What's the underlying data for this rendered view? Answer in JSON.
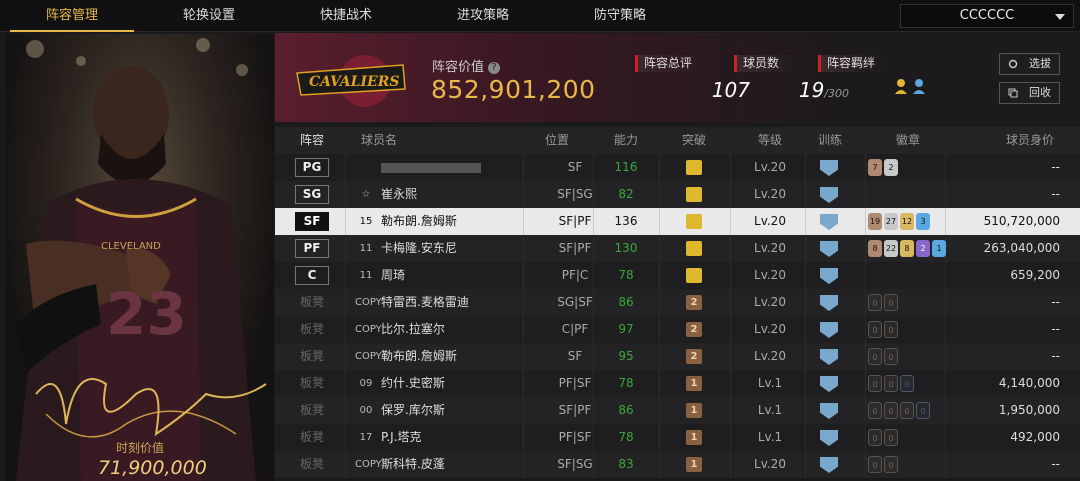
{
  "tabs": [
    "阵容管理",
    "轮换设置",
    "快捷战术",
    "进攻策略",
    "防守策略"
  ],
  "dropdown": "CCCCCC",
  "portrait": {
    "market_label": "时刻价值",
    "market_value": "71,900,000",
    "jersey": "23",
    "team_text": "CLEVELAND"
  },
  "team": {
    "logo_text": "CAVALIERS",
    "value_label": "阵容价值",
    "value": "852,901,200"
  },
  "stats": {
    "total_label": "阵容总评",
    "total": "107",
    "count_label": "球员数",
    "count": "19",
    "count_max": "/300",
    "bond_label": "阵容羁绊"
  },
  "buttons": {
    "select": "选拔",
    "recycle": "回收"
  },
  "columns": [
    "阵容",
    "球员名",
    "位置",
    "能力",
    "突破",
    "等级",
    "训练",
    "徽章",
    "球员身价"
  ],
  "players": [
    {
      "slot": "PG",
      "slot_type": "pos",
      "num": "",
      "name": "",
      "pos": "SF",
      "rating": "116",
      "break": "gold",
      "level": "Lv.20",
      "badges": [
        [
          "b-br",
          "7"
        ],
        [
          "b-si",
          "2"
        ]
      ],
      "value": "--"
    },
    {
      "slot": "SG",
      "slot_type": "pos",
      "num": "☆",
      "name": "崔永熙",
      "pos": "SF|SG",
      "rating": "82",
      "break": "gold",
      "level": "Lv.20",
      "badges": [],
      "value": "--"
    },
    {
      "slot": "SF",
      "slot_type": "pos",
      "num": "15",
      "name": "勒布朗.詹姆斯",
      "pos": "SF|PF",
      "rating": "136",
      "break": "gold",
      "level": "Lv.20",
      "badges": [
        [
          "b-br",
          "19"
        ],
        [
          "b-si",
          "27"
        ],
        [
          "b-go",
          "12"
        ],
        [
          "b-bl",
          "3"
        ]
      ],
      "value": "510,720,000",
      "selected": true
    },
    {
      "slot": "PF",
      "slot_type": "pos",
      "num": "11",
      "name": "卡梅隆.安东尼",
      "pos": "SF|PF",
      "rating": "130",
      "break": "gold",
      "level": "Lv.20",
      "badges": [
        [
          "b-br",
          "8"
        ],
        [
          "b-si",
          "22"
        ],
        [
          "b-go",
          "8"
        ],
        [
          "b-pu",
          "2"
        ],
        [
          "b-bl",
          "1"
        ]
      ],
      "value": "263,040,000"
    },
    {
      "slot": "C",
      "slot_type": "pos",
      "num": "11",
      "name": "周琦",
      "pos": "PF|C",
      "rating": "78",
      "break": "gold",
      "level": "Lv.20",
      "badges": [],
      "value": "659,200"
    },
    {
      "slot": "板凳",
      "slot_type": "bench",
      "num": "COPY",
      "name": "特雷西.麦格雷迪",
      "pos": "SG|SF",
      "rating": "86",
      "break": "2",
      "level": "Lv.20",
      "badges": [
        [
          "b-em",
          "0"
        ],
        [
          "b-em",
          "0"
        ]
      ],
      "value": "--"
    },
    {
      "slot": "板凳",
      "slot_type": "bench",
      "num": "COPY",
      "name": "比尔.拉塞尔",
      "pos": "C|PF",
      "rating": "97",
      "break": "2",
      "level": "Lv.20",
      "badges": [
        [
          "b-em",
          "0"
        ],
        [
          "b-em",
          "0"
        ]
      ],
      "value": "--"
    },
    {
      "slot": "板凳",
      "slot_type": "bench",
      "num": "COPY",
      "name": "勒布朗.詹姆斯",
      "pos": "SF",
      "rating": "95",
      "break": "2",
      "level": "Lv.20",
      "badges": [
        [
          "b-em",
          "0"
        ],
        [
          "b-em",
          "0"
        ]
      ],
      "value": "--"
    },
    {
      "slot": "板凳",
      "slot_type": "bench",
      "num": "09",
      "name": "约什.史密斯",
      "pos": "PF|SF",
      "rating": "78",
      "break": "1",
      "level": "Lv.1",
      "badges": [
        [
          "b-em",
          "0"
        ],
        [
          "b-em",
          "0"
        ],
        [
          "b-emb",
          "0"
        ]
      ],
      "value": "4,140,000"
    },
    {
      "slot": "板凳",
      "slot_type": "bench",
      "num": "00",
      "name": "保罗.库尔斯",
      "pos": "SF|PF",
      "rating": "86",
      "break": "1",
      "level": "Lv.1",
      "badges": [
        [
          "b-em",
          "0"
        ],
        [
          "b-em",
          "0"
        ],
        [
          "b-em",
          "0"
        ],
        [
          "b-emb",
          "0"
        ]
      ],
      "value": "1,950,000"
    },
    {
      "slot": "板凳",
      "slot_type": "bench",
      "num": "17",
      "name": "P.J.塔克",
      "pos": "PF|SF",
      "rating": "78",
      "break": "1",
      "level": "Lv.1",
      "badges": [
        [
          "b-em",
          "0"
        ],
        [
          "b-em",
          "0"
        ]
      ],
      "value": "492,000"
    },
    {
      "slot": "板凳",
      "slot_type": "bench",
      "num": "COPY",
      "name": "斯科特.皮蓬",
      "pos": "SF|SG",
      "rating": "83",
      "break": "1",
      "level": "Lv.20",
      "badges": [
        [
          "b-em",
          "0"
        ],
        [
          "b-em",
          "0"
        ]
      ],
      "value": "--"
    }
  ]
}
